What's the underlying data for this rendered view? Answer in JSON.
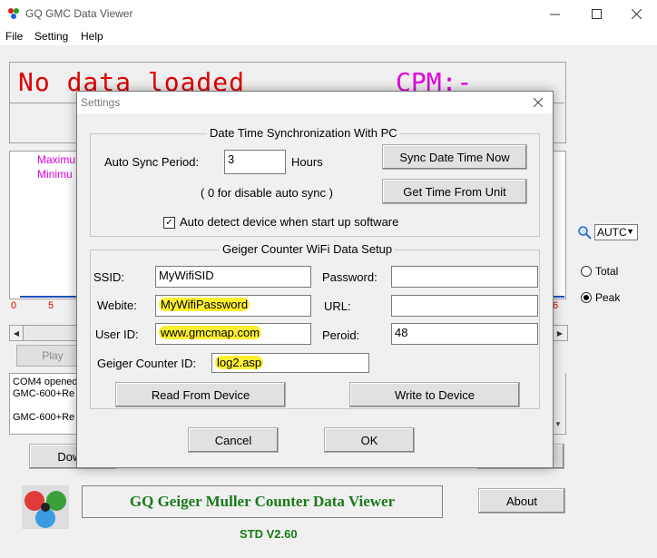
{
  "window": {
    "title": "GQ GMC Data Viewer",
    "minimize_icon": "minimize-icon",
    "maximize_icon": "maximize-icon",
    "close_icon": "close-icon"
  },
  "menu": {
    "items": [
      "File",
      "Setting",
      "Help"
    ]
  },
  "display": {
    "status": "No data loaded",
    "cpm": "CPM:-"
  },
  "chart": {
    "legend": [
      "Maximu",
      "Minimu"
    ],
    "ticks_left": [
      "0",
      "5"
    ],
    "tick_right": "6"
  },
  "controls": {
    "play": "Play",
    "download_partial": "Down",
    "about": "About",
    "range_select": "AUTC",
    "radio_total": "Total",
    "radio_peak": "Peak"
  },
  "log": {
    "lines": [
      "COM4 opened",
      "GMC-600+Re 2",
      "",
      "GMC-600+Re 2"
    ]
  },
  "branding": {
    "banner": "GQ Geiger Muller Counter Data Viewer",
    "version": "STD V2.60"
  },
  "dialog": {
    "title": "Settings",
    "sync_group": {
      "title": "Date Time Synchronization With PC",
      "auto_sync_label": "Auto Sync Period:",
      "auto_sync_value": "3",
      "hours_label": "Hours",
      "sync_now_button": "Sync Date Time Now",
      "get_time_button": "Get Time From Unit",
      "disable_hint": "( 0  for disable auto sync )",
      "auto_detect_label": "Auto detect device when start up software",
      "auto_detect_checked": true
    },
    "wifi_group": {
      "title": "Geiger Counter WiFi Data Setup",
      "ssid_label": "SSID:",
      "ssid_value": "MyWifiSID",
      "password_label": "Password:",
      "password_value": "",
      "website_label": "Webite:",
      "website_value": "MyWifiPassword",
      "url_label": "URL:",
      "url_value": "",
      "userid_label": "User ID:",
      "userid_value": "www.gmcmap.com",
      "period_label": "Peroid:",
      "period_value": "48",
      "counterid_label": "Geiger Counter ID:",
      "counterid_value": "log2.asp",
      "read_button": "Read From Device",
      "write_button": "Write to Device"
    },
    "cancel_button": "Cancel",
    "ok_button": "OK"
  },
  "colors": {
    "status_red": "#e00000",
    "cpm_magenta": "#e000e0",
    "brand_green": "#1a7a1a",
    "highlight_yellow": "#ffef30"
  }
}
